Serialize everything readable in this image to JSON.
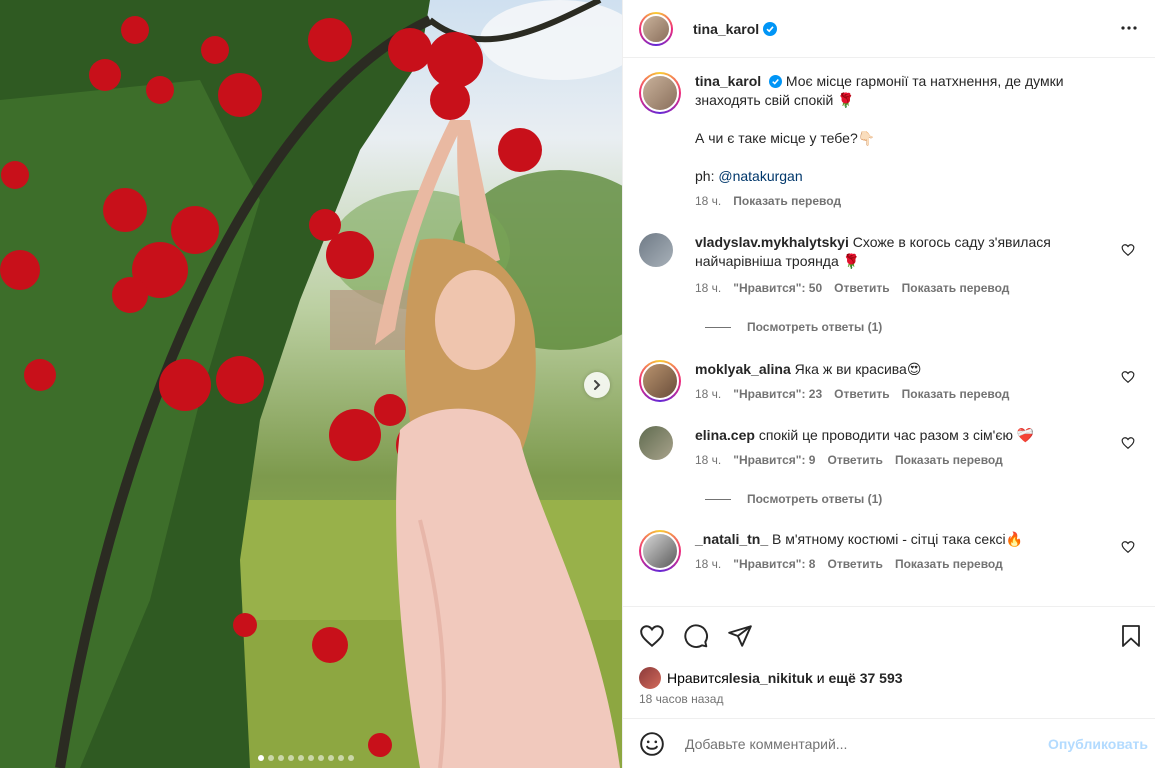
{
  "post": {
    "author": "tina_karol",
    "caption_lines": [
      "Моє місце гармонії та натхнення, де думки",
      "знаходять свій спокій 🌹"
    ],
    "caption_line2": "А чи є таке місце у тебе?👇🏻",
    "caption_credit_prefix": "ph: ",
    "caption_credit_link": "@natakurgan",
    "time": "18 ч.",
    "translate": "Показать перевод"
  },
  "comments": [
    {
      "user": "vladyslav.mykhalytskyi",
      "text_line1": "Схоже в когось саду з'явилася",
      "text_line2": "найчарівніша троянда 🌹",
      "time": "18 ч.",
      "likes": "\"Нравится\": 50",
      "reply": "Ответить",
      "translate": "Показать перевод",
      "view_replies": "Посмотреть ответы (1)"
    },
    {
      "user": "moklyak_alina",
      "text_line1": "Яка ж ви красива😍",
      "time": "18 ч.",
      "likes": "\"Нравится\": 23",
      "reply": "Ответить",
      "translate": "Показать перевод"
    },
    {
      "user": "elina.cep",
      "text_line1": "спокій це проводити час разом з сім'єю ❤️‍🩹",
      "time": "18 ч.",
      "likes": "\"Нравится\": 9",
      "reply": "Ответить",
      "translate": "Показать перевод",
      "view_replies": "Посмотреть ответы (1)"
    },
    {
      "user": "_natali_tn_",
      "text_line1": "В м'ятному костюмі - сітці така сексі🔥",
      "time": "18 ч.",
      "likes": "\"Нравится\": 8",
      "reply": "Ответить",
      "translate": "Показать перевод"
    }
  ],
  "likes_bar": {
    "prefix": "Нравится ",
    "user": "lesia_nikituk",
    "middle": " и ",
    "count": "ещё 37 593"
  },
  "time_ago": "18 часов назад",
  "add_comment": {
    "placeholder": "Добавьте комментарий...",
    "publish": "Опубликовать"
  },
  "colors": {
    "accent": "#0095f6",
    "publish_disabled": "#b3dbff",
    "verified": "#0095f6",
    "rose": "#c8101a"
  },
  "icons": [
    "more-icon",
    "verified-icon",
    "heart-icon",
    "comment-icon",
    "share-icon",
    "bookmark-icon",
    "emoji-icon",
    "chevron-right-icon"
  ],
  "carousel": {
    "slides": 10,
    "active": 0
  }
}
